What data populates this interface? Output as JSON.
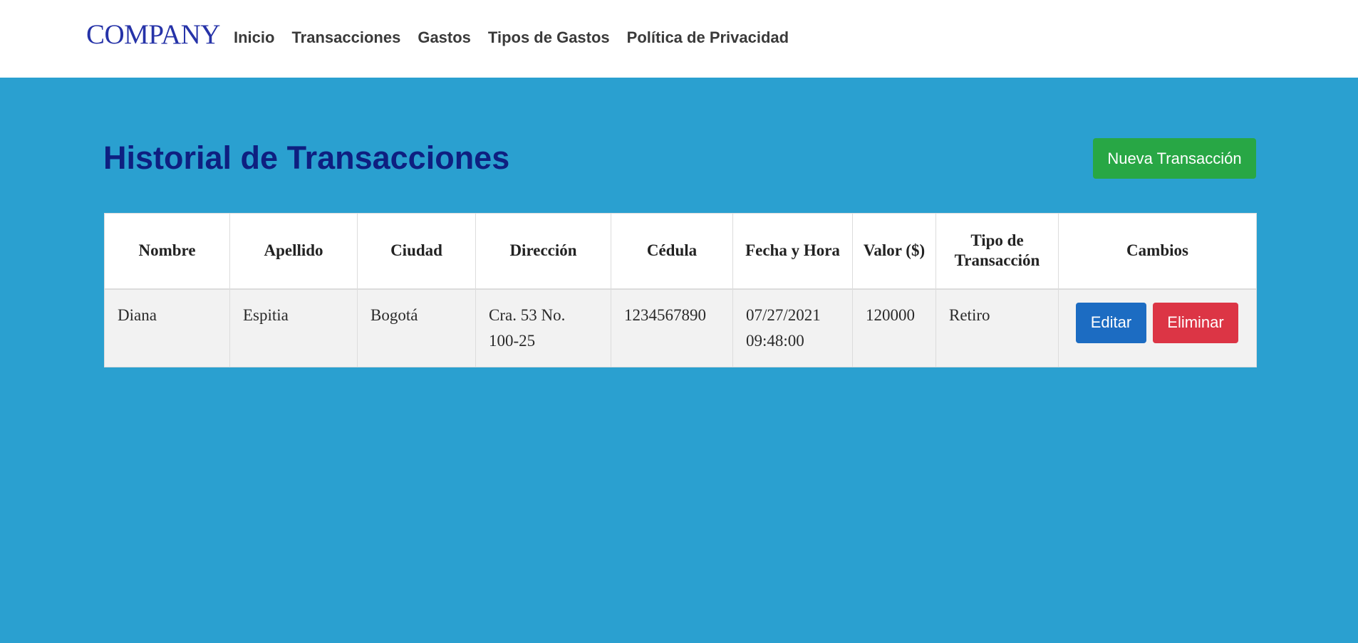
{
  "navbar": {
    "brand": "COMPANY",
    "links": [
      "Inicio",
      "Transacciones",
      "Gastos",
      "Tipos de Gastos",
      "Política de Privacidad"
    ]
  },
  "page": {
    "title": "Historial de Transacciones",
    "new_button": "Nueva Transacción"
  },
  "table": {
    "headers": [
      "Nombre",
      "Apellido",
      "Ciudad",
      "Dirección",
      "Cédula",
      "Fecha y Hora",
      "Valor ($)",
      "Tipo de Transacción",
      "Cambios"
    ],
    "rows": [
      {
        "nombre": "Diana",
        "apellido": "Espitia",
        "ciudad": "Bogotá",
        "direccion": "Cra. 53 No. 100-25",
        "cedula": "1234567890",
        "fecha_hora": "07/27/2021 09:48:00",
        "valor": "120000",
        "tipo": "Retiro",
        "edit_label": "Editar",
        "delete_label": "Eliminar"
      }
    ]
  },
  "colors": {
    "background": "#2aa0d0",
    "title": "#0e1f80",
    "brand": "#2633a8",
    "success": "#28a745",
    "primary": "#1c6cc2",
    "danger": "#dc3545"
  }
}
